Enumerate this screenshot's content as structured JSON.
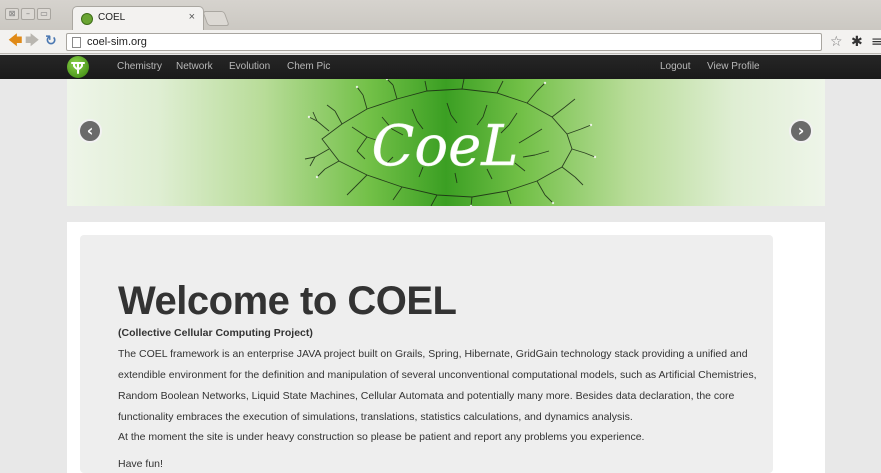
{
  "browser": {
    "window_buttons": [
      "⊠",
      "–",
      "▭"
    ],
    "tab_title": "COEL",
    "tab_close": "×",
    "url": "coel-sim.org",
    "icons": [
      "back-arrow",
      "forward-arrow",
      "reload",
      "page",
      "bookmark-star",
      "settings-gear",
      "menu"
    ]
  },
  "navbar": {
    "links": [
      "Chemistry",
      "Network",
      "Evolution",
      "Chem Pic"
    ],
    "right_links": [
      "Logout",
      "View Profile"
    ]
  },
  "banner": {
    "logo_text": "CoeL",
    "prev": "‹",
    "next": "›"
  },
  "hero": {
    "title": "Welcome to COEL",
    "subtitle": "(Collective Cellular Computing Project)",
    "paragraph": "The COEL framework is an enterprise JAVA project built on Grails, Spring, Hibernate, GridGain technology stack providing a unified and extendible environment for the definition and manipulation of several unconventional computational models, such as Artificial Chemistries, Random Boolean Networks, Liquid State Machines, Cellular Automata and potentially many more. Besides data declaration, the core functionality embraces the execution of simulations, translations, statistics calculations, and dynamics analysis.",
    "paragraph2": "At the moment the site is under heavy construction so please be patient and report any problems you experience.",
    "paragraph3": "Have fun!"
  },
  "colors": {
    "navbar": "#1f1f1f",
    "banner_green": "#3b9f23",
    "hero_bg": "#eeeeee",
    "text": "#333333"
  }
}
